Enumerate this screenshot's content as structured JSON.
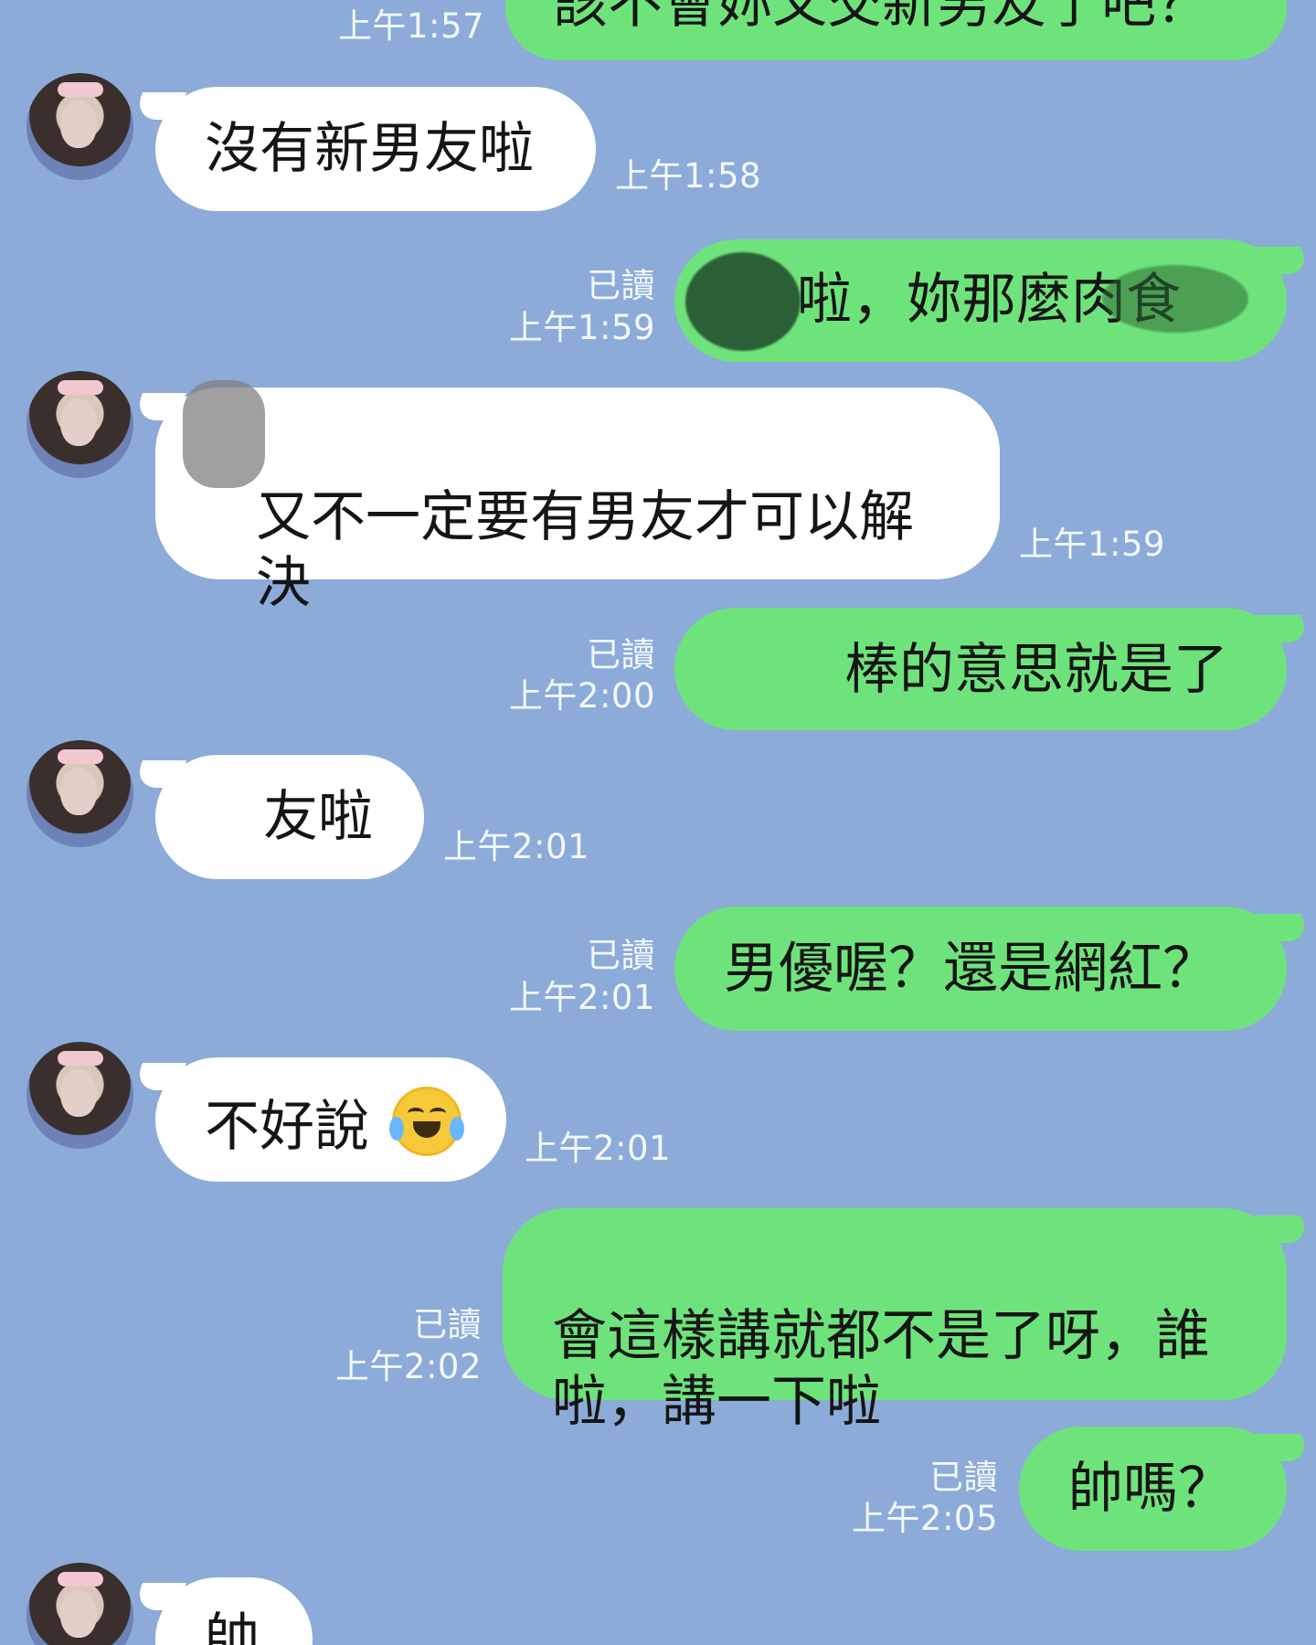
{
  "messages": [
    {
      "type": "sent",
      "text": "該不會妳又交新男友了吧？",
      "read": "",
      "time": "上午1:57"
    },
    {
      "type": "received",
      "text": "沒有新男友啦",
      "time": "上午1:58"
    },
    {
      "type": "sent",
      "text": "啦，妳那麼肉食",
      "read": "已讀",
      "time": "上午1:59"
    },
    {
      "type": "received",
      "text": "又不一定要有男友才可以解\n決",
      "time": "上午1:59"
    },
    {
      "type": "sent",
      "text": "棒的意思就是了",
      "read": "已讀",
      "time": "上午2:00"
    },
    {
      "type": "received",
      "text": "友啦",
      "time": "上午2:01"
    },
    {
      "type": "sent",
      "text": "男優喔？還是網紅？",
      "read": "已讀",
      "time": "上午2:01"
    },
    {
      "type": "received",
      "text": "不好說",
      "time": "上午2:01",
      "emoji": "joy-tears"
    },
    {
      "type": "sent",
      "text": "會這樣講就都不是了呀，誰\n啦，講一下啦",
      "read": "已讀",
      "time": "上午2:02"
    },
    {
      "type": "sent",
      "text": "帥嗎？",
      "read": "已讀",
      "time": "上午2:05"
    },
    {
      "type": "received",
      "text": "帥",
      "time": ""
    }
  ]
}
